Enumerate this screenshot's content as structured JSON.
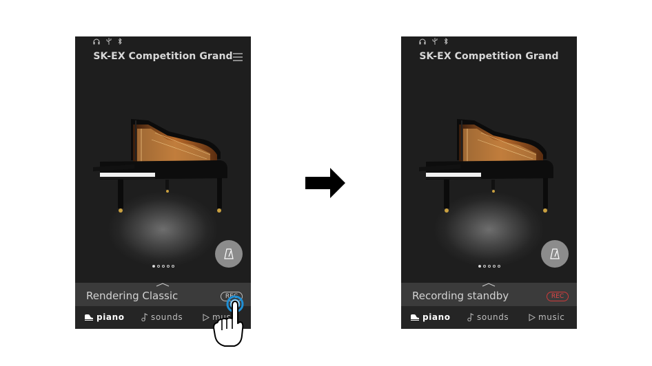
{
  "colors": {
    "accent_blue": "#1f8fd6",
    "rec_red": "#d03a3a",
    "screen_bg": "#1e1e1e",
    "info_bar": "#3b3b3b",
    "nav_bar": "#252525"
  },
  "status_icons": [
    "headphones-icon",
    "usb-icon",
    "bluetooth-icon"
  ],
  "screens": {
    "left": {
      "title": "SK-EX Competition Grand",
      "info_text": "Rendering Classic",
      "rec_label": "REC",
      "nav": {
        "piano": "piano",
        "sounds": "sounds",
        "music": "music"
      }
    },
    "right": {
      "title": "SK-EX Competition Grand",
      "info_text": "Recording standby",
      "rec_label": "REC",
      "nav": {
        "piano": "piano",
        "sounds": "sounds",
        "music": "music"
      }
    }
  },
  "page_indicator": {
    "count": 5,
    "active": 1
  }
}
